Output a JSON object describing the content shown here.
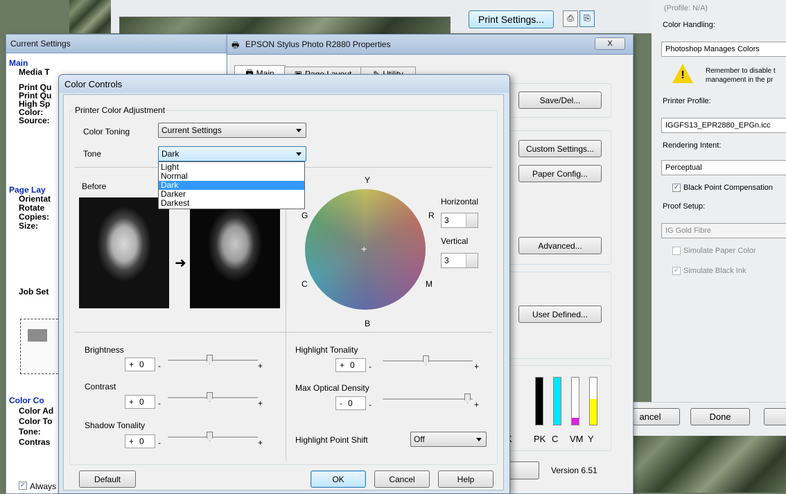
{
  "photoshop_top": {
    "print_settings_label": "Print Settings..."
  },
  "photoshop_right": {
    "profile_na": "(Profile: N/A)",
    "color_handling_label": "Color Handling:",
    "color_handling_value": "Photoshop Manages Colors",
    "warning_text": "Remember to disable t\nmanagement in the pr",
    "printer_profile_label": "Printer Profile:",
    "printer_profile_value": "IGGFS13_EPR2880_EPGn.icc",
    "rendering_intent_label": "Rendering Intent:",
    "rendering_intent_value": "Perceptual",
    "bpc_label": "Black Point Compensation",
    "bpc_checked": true,
    "proof_setup_label": "Proof Setup:",
    "proof_setup_value": "IG Gold Fibre",
    "simulate_paper_label": "Simulate Paper Color",
    "simulate_black_label": "Simulate Black Ink",
    "cancel_label": "ancel",
    "done_label": "Done"
  },
  "current_settings": {
    "title": "Current Settings",
    "main_heading": "Main",
    "main_rows": [
      "Media T",
      "Print Qu",
      "Print Qu",
      "High Sp",
      "Color:",
      "Source:"
    ],
    "page_heading": "Page Lay",
    "page_rows": [
      "Orientat",
      "Rotate",
      "Copies:",
      "Size:"
    ],
    "job_heading": "Job Set",
    "color_heading": "Color Co",
    "color_rows": [
      "Color Ad",
      "Color To",
      "Tone:",
      "Contras"
    ],
    "always_label": "Always"
  },
  "epson": {
    "title": "EPSON Stylus Photo R2880 Properties",
    "close_label": "X",
    "tabs": [
      "Main",
      "Page Layout",
      "Utility"
    ],
    "save_del": "Save/Del...",
    "custom_settings": "Custom Settings...",
    "paper_config": "Paper Config...",
    "advanced": "Advanced...",
    "user_defined": "User Defined...",
    "ink_labels": [
      "K",
      "PK",
      "C",
      "VM",
      "Y"
    ],
    "ink_levels": [
      0.0,
      1.0,
      1.0,
      0.15,
      0.55
    ],
    "ink_colors": [
      "#000000",
      "#000000",
      "#00e5ff",
      "#e020e0",
      "#ffff00"
    ],
    "version": "Version 6.51"
  },
  "color_controls": {
    "title": "Color Controls",
    "group_label": "Printer Color Adjustment",
    "color_toning_label": "Color Toning",
    "color_toning_value": "Current Settings",
    "tone_label": "Tone",
    "tone_value": "Dark",
    "tone_options": [
      "Light",
      "Normal",
      "Dark",
      "Darker",
      "Darkest"
    ],
    "tone_selected_index": 2,
    "before_label": "Before",
    "wheel": {
      "y": "Y",
      "r": "R",
      "m": "M",
      "b": "B",
      "c": "C",
      "g": "G",
      "center": "+"
    },
    "horizontal_label": "Horizontal",
    "horizontal_value": "3",
    "vertical_label": "Vertical",
    "vertical_value": "3",
    "brightness_label": "Brightness",
    "brightness_sign": "+",
    "brightness_value": "0",
    "contrast_label": "Contrast",
    "contrast_sign": "+",
    "contrast_value": "0",
    "shadow_label": "Shadow Tonality",
    "shadow_sign": "+",
    "shadow_value": "0",
    "highlight_label": "Highlight Tonality",
    "highlight_sign": "+",
    "highlight_value": "0",
    "maxdensity_label": "Max Optical Density",
    "maxdensity_sign": "-",
    "maxdensity_value": "0",
    "slider_minus": "-",
    "slider_plus": "+",
    "shift_label": "Highlight Point Shift",
    "shift_value": "Off",
    "default_label": "Default",
    "ok_label": "OK",
    "cancel_label": "Cancel",
    "help_label": "Help"
  }
}
